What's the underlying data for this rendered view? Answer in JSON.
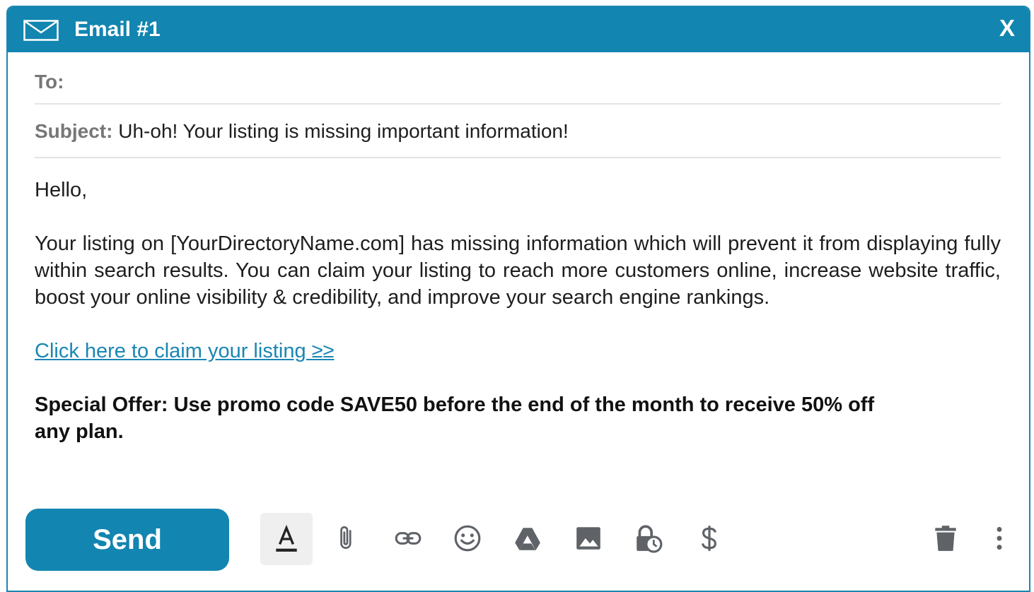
{
  "window": {
    "title": "Email #1",
    "close_label": "X"
  },
  "fields": {
    "to_label": "To:",
    "to_value": "",
    "subject_label": "Subject:",
    "subject_value": "Uh-oh! Your listing is missing important information!"
  },
  "body": {
    "greeting": "Hello,",
    "paragraph": "Your listing on [YourDirectoryName.com] has missing information which will prevent it from displaying fully within search results. You can claim your listing to reach more customers online, increase website traffic, boost your online visibility & credibility, and improve your search engine rankings.",
    "link_text": "Click here to claim your listing ≥≥",
    "offer": "Special Offer: Use promo code SAVE50 before the end of the month to receive 50% off any plan."
  },
  "toolbar": {
    "send_label": "Send",
    "icons": [
      "text-format-icon",
      "attachment-icon",
      "link-icon",
      "emoji-icon",
      "drive-icon",
      "image-icon",
      "confidential-icon",
      "dollar-icon",
      "trash-icon",
      "more-options-icon"
    ]
  },
  "colors": {
    "accent": "#1285b0",
    "link": "#1a86b4",
    "icon": "#5f6368"
  }
}
